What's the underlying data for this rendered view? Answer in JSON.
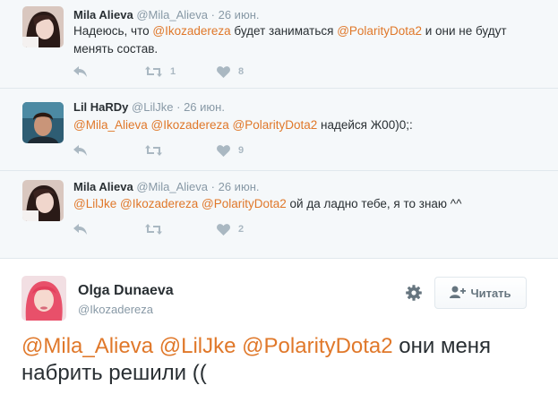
{
  "replies": [
    {
      "name": "Mila Alieva",
      "handle": "@Mila_Alieva",
      "dot": "·",
      "time": "26 июн.",
      "text_parts": [
        {
          "t": "Надеюсь, что ",
          "m": false
        },
        {
          "t": "@Ikozadereza",
          "m": true
        },
        {
          "t": " будет заниматься ",
          "m": false
        },
        {
          "t": "@PolarityDota2",
          "m": true
        },
        {
          "t": " и они не будут менять состав.",
          "m": false
        }
      ],
      "retweets": "1",
      "likes": "8"
    },
    {
      "name": "Lil HaRDy",
      "handle": "@LilJke",
      "dot": "·",
      "time": "26 июн.",
      "text_parts": [
        {
          "t": "@Mila_Alieva",
          "m": true
        },
        {
          "t": " ",
          "m": false
        },
        {
          "t": "@Ikozadereza",
          "m": true
        },
        {
          "t": " ",
          "m": false
        },
        {
          "t": "@PolarityDota2",
          "m": true
        },
        {
          "t": " надейся Ж00)0;:",
          "m": false
        }
      ],
      "retweets": "",
      "likes": "9"
    },
    {
      "name": "Mila Alieva",
      "handle": "@Mila_Alieva",
      "dot": "·",
      "time": "26 июн.",
      "text_parts": [
        {
          "t": "@LilJke",
          "m": true
        },
        {
          "t": " ",
          "m": false
        },
        {
          "t": "@Ikozadereza",
          "m": true
        },
        {
          "t": " ",
          "m": false
        },
        {
          "t": "@PolarityDota2",
          "m": true
        },
        {
          "t": " ой да ладно тебе, я то знаю ^^",
          "m": false
        }
      ],
      "retweets": "",
      "likes": "2"
    }
  ],
  "main_tweet": {
    "name": "Olga Dunaeva",
    "handle": "@Ikozadereza",
    "follow_label": "Читать",
    "text_parts": [
      {
        "t": "@Mila_Alieva",
        "m": true
      },
      {
        "t": " ",
        "m": false
      },
      {
        "t": "@LilJke",
        "m": true
      },
      {
        "t": " ",
        "m": false
      },
      {
        "t": "@PolarityDota2",
        "m": true
      },
      {
        "t": " они меня набрить решили ((",
        "m": false
      }
    ]
  },
  "icons": {
    "reply": "reply-icon",
    "retweet": "retweet-icon",
    "like": "heart-icon",
    "more": "more-icon",
    "settings": "gear-icon",
    "follow": "add-user-icon"
  },
  "colors": {
    "mention": "#e0782a",
    "thread_bg": "#f5f8fa",
    "muted": "#8899a6",
    "icon": "#aab8c2"
  }
}
